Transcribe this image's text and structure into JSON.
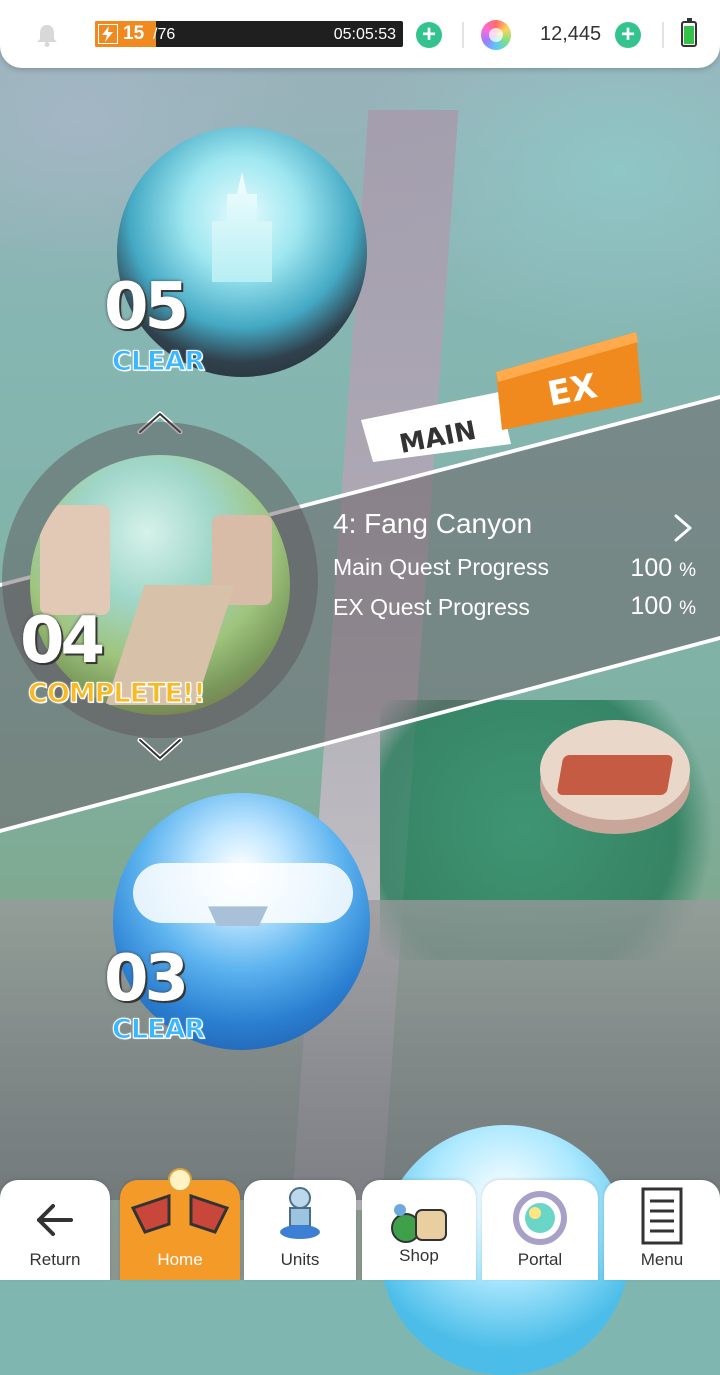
{
  "top_bar": {
    "stamina_current": "15",
    "stamina_max": "/76",
    "stamina_fraction": 0.197,
    "stamina_timer": "05:05:53",
    "gem_count": "12,445",
    "icons": [
      "bell-icon",
      "lightning-bolt-icon",
      "plus-icon",
      "rainbow-gem-icon",
      "battery-icon"
    ],
    "colors": {
      "stamina_fill": "#f08a1e",
      "plus_button": "#33c38e",
      "battery": "#35c24a"
    }
  },
  "stages": [
    {
      "number": "05",
      "status": "CLEAR"
    },
    {
      "number": "04",
      "status": "COMPLETE!!"
    },
    {
      "number": "03",
      "status": "CLEAR"
    }
  ],
  "tabs": {
    "main": "MAIN",
    "ex": "EX",
    "active": "EX"
  },
  "stage_info": {
    "title": "4: Fang Canyon",
    "main_label": "Main Quest Progress",
    "main_value": "100",
    "ex_label": "EX Quest Progress",
    "ex_value": "100",
    "unit": "%"
  },
  "nav": {
    "return": "Return",
    "home": "Home",
    "units": "Units",
    "shop": "Shop",
    "portal": "Portal",
    "menu": "Menu",
    "active": "Home",
    "active_color": "#f49a28"
  }
}
